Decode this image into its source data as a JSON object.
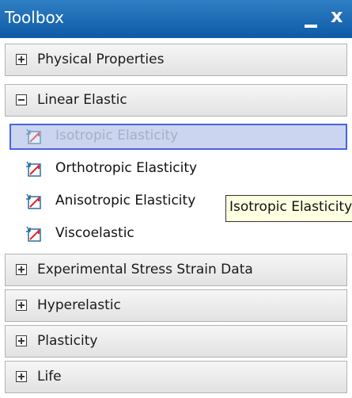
{
  "toolbox": {
    "title": "Toolbox",
    "close_glyph": "x",
    "pin_icon": "minimize-dash-icon",
    "sections": [
      {
        "label": "Physical Properties",
        "expanded": false,
        "expander_icon": "plus-box-icon"
      },
      {
        "label": "Linear Elastic",
        "expanded": true,
        "expander_icon": "minus-box-icon",
        "items": [
          {
            "label": "Isotropic Elasticity",
            "state": "selected-dragging",
            "icon": "stress-strain-chart-icon"
          },
          {
            "label": "Orthotropic Elasticity",
            "icon": "stress-strain-chart-icon"
          },
          {
            "label": "Anisotropic Elasticity",
            "icon": "stress-strain-chart-icon"
          },
          {
            "label": "Viscoelastic",
            "icon": "stress-strain-chart-icon"
          }
        ]
      },
      {
        "label": "Experimental Stress Strain Data",
        "expanded": false,
        "expander_icon": "plus-box-icon"
      },
      {
        "label": "Hyperelastic",
        "expanded": false,
        "expander_icon": "plus-box-icon"
      },
      {
        "label": "Plasticity",
        "expanded": false,
        "expander_icon": "plus-box-icon"
      },
      {
        "label": "Life",
        "expanded": false,
        "expander_icon": "plus-box-icon"
      }
    ]
  },
  "tooltip": {
    "text": "Isotropic Elasticity"
  },
  "colors": {
    "title_bar": "#0f5aa6",
    "selection_fill": "#cbd5ef",
    "selection_border": "#4a63e0",
    "tooltip_bg": "#ffffe1",
    "icon_curve": "#e0202a",
    "icon_frame": "#2a6f9a"
  }
}
